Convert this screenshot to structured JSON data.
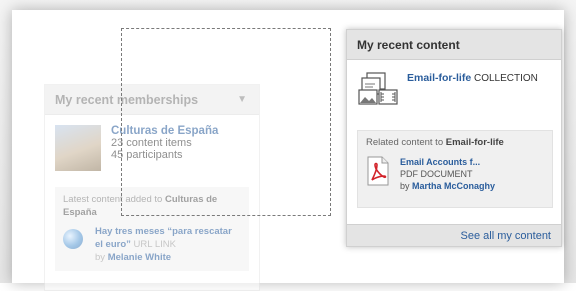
{
  "memberships": {
    "title": "My recent memberships",
    "collapse_arrow": "▼",
    "item": {
      "name": "Culturas de España",
      "content_items": "23 content items",
      "participants": "45 participants"
    },
    "latest": {
      "caption_prefix": "Latest content added to",
      "caption_target": "Culturas de España",
      "link": "Hay tres meses “para rescatar el euro”",
      "type": "URL LINK",
      "by_prefix": "by",
      "author": "Melanie White"
    }
  },
  "recent_content": {
    "title": "My recent content",
    "item": {
      "name": "Email-for-life",
      "type": "COLLECTION"
    },
    "related": {
      "caption_prefix": "Related content to",
      "caption_target": "Email-for-life",
      "link": "Email Accounts f...",
      "type": "PDF DOCUMENT",
      "by_prefix": "by",
      "author": "Martha McConaghy"
    },
    "footer_link": "See all my content"
  },
  "icons": {
    "membership_thumb": "group-photo-icon",
    "latest_item": "globe-icon",
    "recent_item": "collection-icon",
    "related_item": "pdf-icon"
  },
  "colors": {
    "link": "#2a5d9c",
    "header": "#e4e4e4"
  }
}
